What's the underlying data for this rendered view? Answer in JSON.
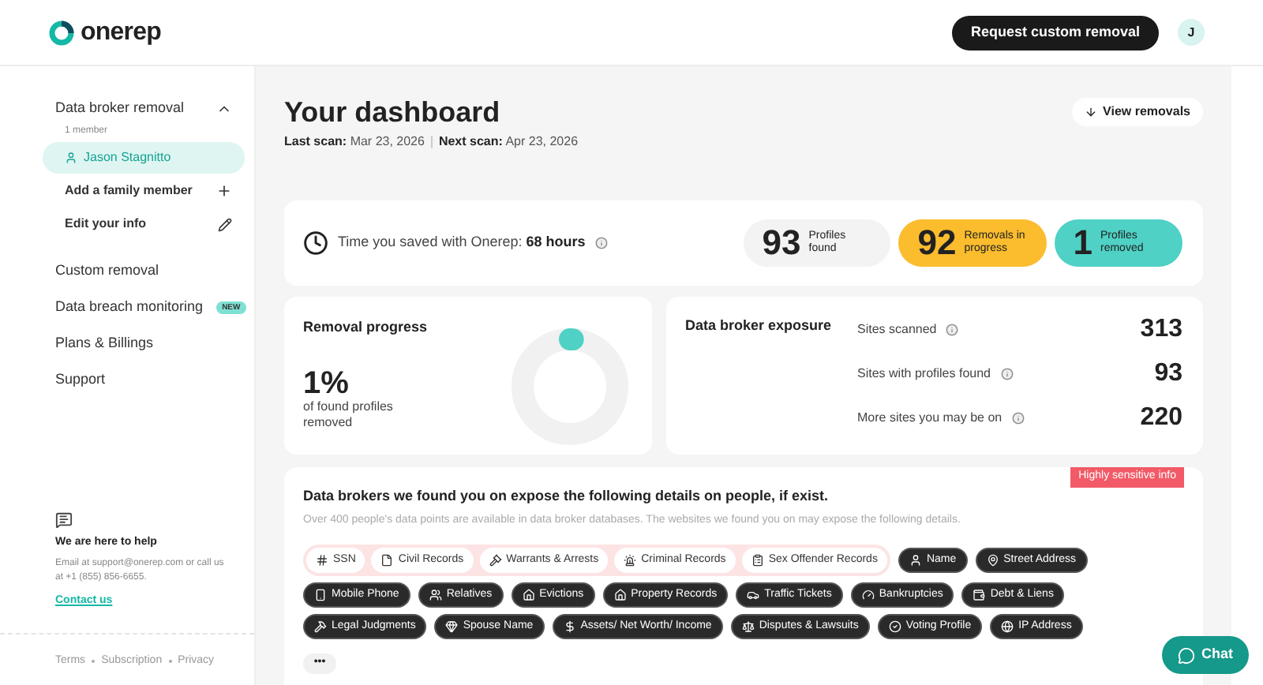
{
  "header": {
    "logo": "onerep",
    "request_button": "Request custom removal",
    "avatar": "J"
  },
  "sidebar": {
    "section": {
      "label": "Data broker removal",
      "expanded": true,
      "member_count": "1 member",
      "member": {
        "name": "Jason Stagnitto",
        "selected": true
      },
      "actions": [
        {
          "label": "Add a family member",
          "kind": "add"
        },
        {
          "label": "Edit your info",
          "kind": "edit"
        }
      ]
    },
    "items": [
      {
        "label": "Custom removal"
      },
      {
        "label": "Data breach monitoring",
        "badge": "NEW"
      },
      {
        "label": "Plans & Billings"
      },
      {
        "label": "Support"
      }
    ],
    "help": {
      "title": "We are here to help",
      "text": "Email at support@onerep.com or call us at +1 (855) 856-6655.",
      "link": "Contact us"
    },
    "footer_links": [
      "Terms",
      "Subscription",
      "Privacy"
    ]
  },
  "dashboard": {
    "title": "Your dashboard",
    "last_scan_label": "Last scan:",
    "last_scan": "Mar 23, 2026",
    "next_scan_label": "Next scan:",
    "next_scan": "Apr 23, 2026",
    "view_button": "View removals"
  },
  "time_saved": {
    "text": "Time you saved with Onerep:",
    "value": "68 hours"
  },
  "stats": [
    {
      "number": "93",
      "label": "Profiles found",
      "color": "#f3f3f3"
    },
    {
      "number": "92",
      "label": "Removals in progress",
      "color": "#fbbc2e"
    },
    {
      "number": "1",
      "label": "Profiles removed",
      "color": "#4fd1c5"
    }
  ],
  "removal_progress": {
    "title": "Removal progress",
    "percent": "1%",
    "caption": "of found profiles removed",
    "level": 0.01
  },
  "exposure": {
    "title": "Data broker exposure",
    "rows": [
      {
        "label": "Sites scanned",
        "value": "313"
      },
      {
        "label": "Sites with profiles found",
        "value": "93"
      },
      {
        "label": "More sites you may be on",
        "value": "220"
      }
    ]
  },
  "details": {
    "title": "Data brokers we found you on expose the following details on people, if exist.",
    "subtitle": "Over 400 people's data points are available in data broker databases. The websites we found you on may expose the following details.",
    "sensitive_badge": "Highly sensitive info",
    "sensitive_tags": [
      {
        "label": "SSN"
      },
      {
        "label": "Civil Records"
      },
      {
        "label": "Warrants & Arrests"
      },
      {
        "label": "Criminal Records"
      },
      {
        "label": "Sex Offender Records"
      }
    ],
    "tags": [
      {
        "label": "Name"
      },
      {
        "label": "Street Address"
      },
      {
        "label": "Mobile Phone"
      },
      {
        "label": "Relatives"
      },
      {
        "label": "Evictions"
      },
      {
        "label": "Property Records"
      },
      {
        "label": "Traffic Tickets"
      },
      {
        "label": "Bankruptcies"
      },
      {
        "label": "Debt & Liens"
      },
      {
        "label": "Legal Judgments"
      },
      {
        "label": "Spouse Name"
      },
      {
        "label": "Assets/ Net Worth/ Income"
      },
      {
        "label": "Disputes & Lawsuits"
      },
      {
        "label": "Voting Profile"
      },
      {
        "label": "IP Address"
      }
    ],
    "more": "•••"
  },
  "chat_button": "Chat"
}
